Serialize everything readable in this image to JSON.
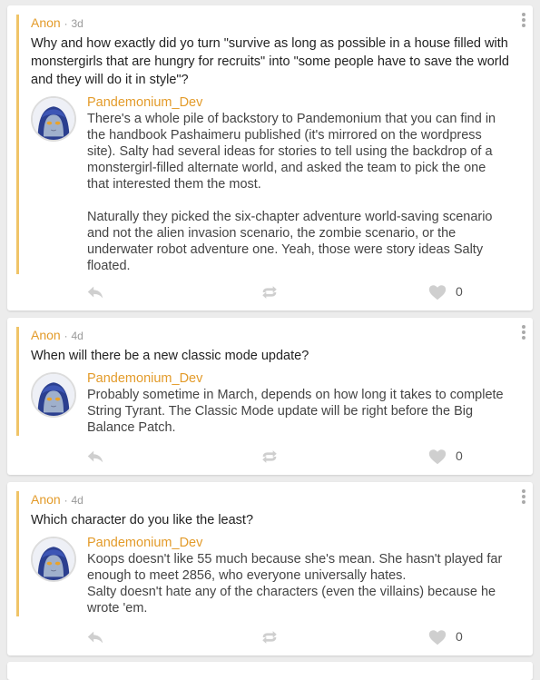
{
  "posts": [
    {
      "asker": "Anon",
      "time": "3d",
      "question": "Why and how exactly did yo turn \"survive as long as possible in a house filled with monstergirls that are hungry for recruits\" into \"some people have to save the world and they will do it in style\"?",
      "answerer": "Pandemonium_Dev",
      "answer": "There's a whole pile of backstory to Pandemonium that you can find in the handbook Pashaimeru published (it's mirrored on the wordpress site). Salty had several ideas for stories to tell using the backdrop of a monstergirl-filled alternate world, and asked the team to pick the one that interested them the most.\n\nNaturally they picked the six-chapter adventure world-saving scenario and not the alien invasion scenario, the zombie scenario, or the underwater robot adventure one. Yeah, those were story ideas Salty floated.",
      "likes": "0"
    },
    {
      "asker": "Anon",
      "time": "4d",
      "question": "When will there be a new classic mode update?",
      "answerer": "Pandemonium_Dev",
      "answer": "Probably sometime in March, depends on how long it takes to complete String Tyrant. The Classic Mode update will be right before the Big Balance Patch.",
      "likes": "0"
    },
    {
      "asker": "Anon",
      "time": "4d",
      "question": "Which character do you like the least?",
      "answerer": "Pandemonium_Dev",
      "answer": "Koops doesn't like 55 much because she's mean. She hasn't played far enough to meet 2856, who everyone universally hates.\nSalty doesn't hate any of the characters (even the villains) because he wrote 'em.",
      "likes": "0"
    }
  ],
  "separator": "·",
  "icons": {
    "reply": "reply-icon",
    "share": "share-icon",
    "like": "heart-icon",
    "menu": "more-vertical-icon",
    "avatar": "avatar-image"
  },
  "colors": {
    "name": "#e39b2a",
    "quote_bar": "#f0c468",
    "icon": "#c8c8c8"
  }
}
